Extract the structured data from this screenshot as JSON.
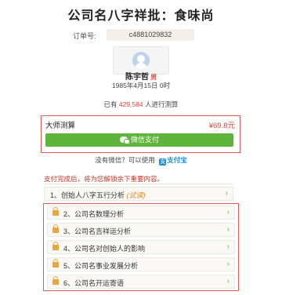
{
  "title": "公司名八字祥批：食味尚",
  "order": {
    "label": "订单号:",
    "value": "c4881029832"
  },
  "profile": {
    "name": "陈宇哲",
    "gender": "男",
    "birth": "1985年4月15日 0时"
  },
  "count": {
    "prefix": "已有",
    "number": "429,584",
    "suffix": "人进行测算"
  },
  "payment": {
    "title": "大师测算",
    "price": "¥69.8元",
    "wechat_label": "微信支付",
    "alt_text": "没有微信？可以使用",
    "alipay_label": "支付宝",
    "alipay_glyph": "支"
  },
  "notice": "支付完成后，将为您解锁余下重要内容。",
  "free_item": {
    "label": "1、创始人八字五行分析",
    "trial": "(试读)"
  },
  "locked_items": [
    {
      "label": "2、公司名数理分析"
    },
    {
      "label": "3、公司名吉祥运分析"
    },
    {
      "label": "4、公司名对创始人的影响"
    },
    {
      "label": "5、公司名事业发展分析"
    },
    {
      "label": "6、公司名开运寄语"
    }
  ],
  "chevron": "›",
  "colors": {
    "accent_red": "#e0443e",
    "wechat_green": "#5fb53b",
    "alipay_blue": "#1a8ee5",
    "lock_orange": "#e7a73a"
  }
}
